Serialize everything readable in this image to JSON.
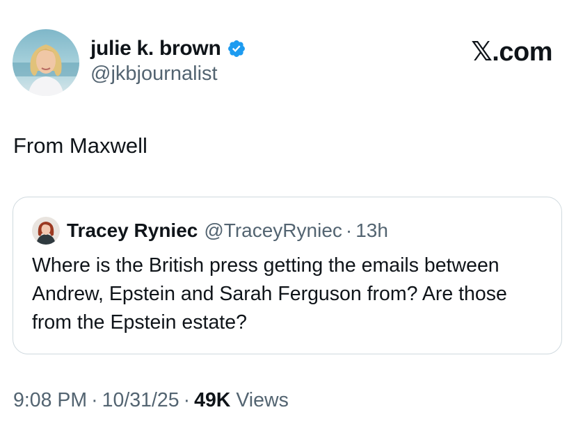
{
  "author": {
    "name": "julie k. brown",
    "handle": "@jkbjournalist",
    "verified_icon": "verified-badge-icon",
    "verified_color": "#1d9bf0"
  },
  "brand": "𝕏.com",
  "tweet": {
    "text": "From Maxwell"
  },
  "quote": {
    "name": "Tracey Ryniec",
    "handle": "@TraceyRyniec",
    "separator": "·",
    "time": "13h",
    "text": "Where is the British press getting the emails between Andrew, Epstein and Sarah Ferguson from? Are those from the Epstein estate?"
  },
  "meta": {
    "time": "9:08 PM",
    "date": "10/31/25",
    "separator": "·",
    "views_count": "49K",
    "views_label": "Views"
  },
  "colors": {
    "text_primary": "#0f1419",
    "text_secondary": "#536471",
    "border": "#cfd9de"
  }
}
